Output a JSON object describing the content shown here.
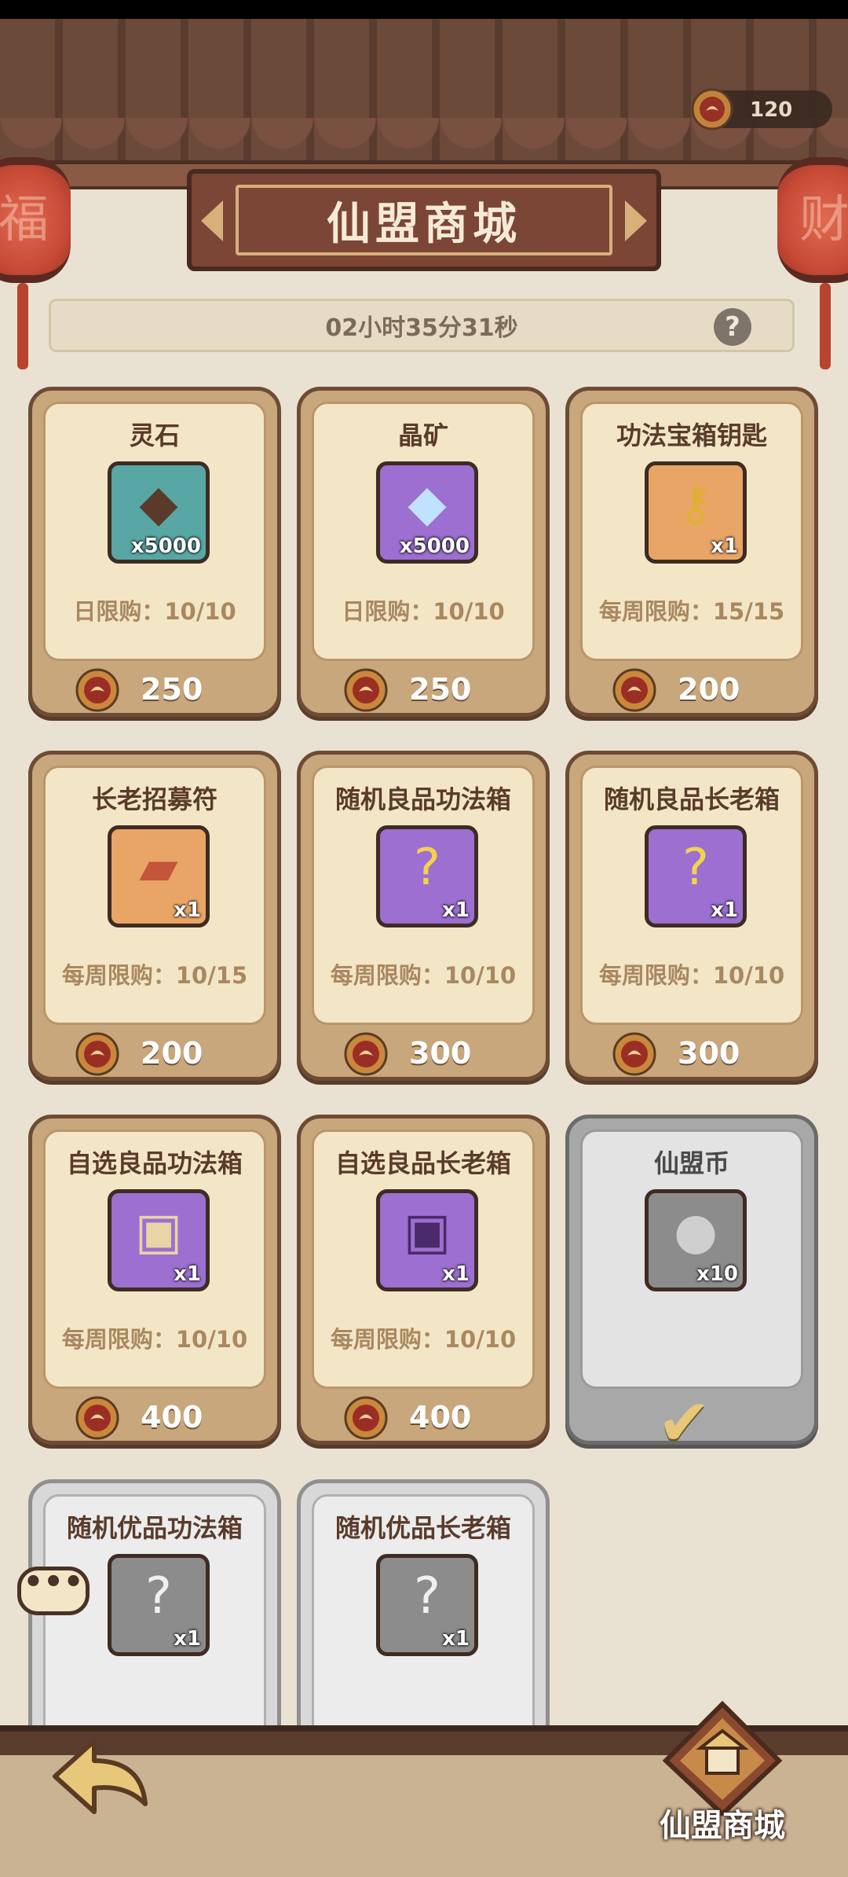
{
  "header": {
    "currency_amount": "120",
    "title": "仙盟商城",
    "timer": "02小时35分31秒",
    "help_symbol": "?"
  },
  "lanterns": {
    "left_char": "福",
    "right_char": "财"
  },
  "items": [
    {
      "name": "灵石",
      "qty": "x5000",
      "limit": "日限购：10/10",
      "price": "250",
      "icon": "spirit-stone-icon",
      "color": "cyan"
    },
    {
      "name": "晶矿",
      "qty": "x5000",
      "limit": "日限购：10/10",
      "price": "250",
      "icon": "crystal-ore-icon",
      "color": "purple"
    },
    {
      "name": "功法宝箱钥匙",
      "qty": "x1",
      "limit": "每周限购：15/15",
      "price": "200",
      "icon": "golden-key-icon",
      "color": "orange"
    },
    {
      "name": "长老招募符",
      "qty": "x1",
      "limit": "每周限购：10/15",
      "price": "200",
      "icon": "recruit-talisman-icon",
      "color": "orange"
    },
    {
      "name": "随机良品功法箱",
      "qty": "x1",
      "limit": "每周限购：10/10",
      "price": "300",
      "icon": "mystery-chest-icon",
      "color": "purple"
    },
    {
      "name": "随机良品长老箱",
      "qty": "x1",
      "limit": "每周限购：10/10",
      "price": "300",
      "icon": "mystery-chest-icon",
      "color": "purple"
    },
    {
      "name": "自选良品功法箱",
      "qty": "x1",
      "limit": "每周限购：10/10",
      "price": "400",
      "icon": "treasure-chest-icon",
      "color": "purple"
    },
    {
      "name": "自选良品长老箱",
      "qty": "x1",
      "limit": "每周限购：10/10",
      "price": "400",
      "icon": "treasure-chest-icon",
      "color": "purple"
    },
    {
      "name": "仙盟币",
      "qty": "x10",
      "icon": "alliance-coin-icon",
      "color": "gray",
      "status": "claimed"
    },
    {
      "name": "随机优品功法箱",
      "qty": "x1",
      "icon": "mystery-chest-icon",
      "color": "gray",
      "status": "locked"
    },
    {
      "name": "随机优品长老箱",
      "qty": "x1",
      "icon": "mystery-chest-icon",
      "color": "gray",
      "status": "locked"
    }
  ],
  "chat_symbol": "•••",
  "footer": {
    "shop_label": "仙盟商城"
  },
  "colors": {
    "card_bg": "#c7a77b",
    "card_paper": "#f3e6c6",
    "banner": "#7b4636",
    "gold_accent": "#d7b07a"
  }
}
